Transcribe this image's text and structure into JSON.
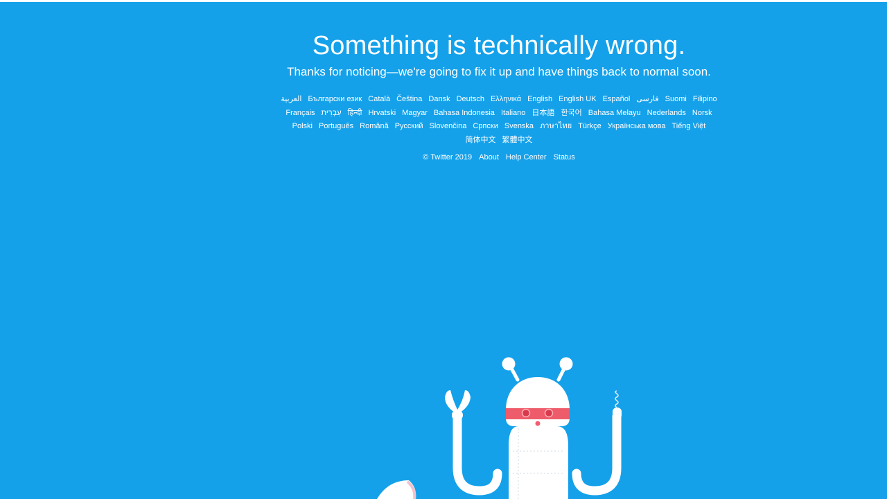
{
  "error": {
    "headline": "Something is technically wrong.",
    "message": "Thanks for noticing—we're going to fix it up and have things back to normal soon."
  },
  "languages": [
    "العربية",
    "Български език",
    "Català",
    "Čeština",
    "Dansk",
    "Deutsch",
    "Ελληνικά",
    "English",
    "English UK",
    "Español",
    "فارسی",
    "Suomi",
    "Filipino",
    "Français",
    "עִבְרִית",
    "हिन्दी",
    "Hrvatski",
    "Magyar",
    "Bahasa Indonesia",
    "Italiano",
    "日本語",
    "한국어",
    "Bahasa Melayu",
    "Nederlands",
    "Norsk",
    "Polski",
    "Português",
    "Română",
    "Русский",
    "Slovenčina",
    "Српски",
    "Svenska",
    "ภาษาไทย",
    "Türkçe",
    "Українська мова",
    "Tiếng Việt",
    "简体中文",
    "繁體中文"
  ],
  "footer": {
    "copyright": "© Twitter 2019",
    "about": "About",
    "help_center": "Help Center",
    "status": "Status"
  },
  "colors": {
    "background": "#14a1ea",
    "text": "#ffffff",
    "robot_mask": "#ee5b6a"
  },
  "illustration": {
    "icon": "robot-illustration"
  }
}
